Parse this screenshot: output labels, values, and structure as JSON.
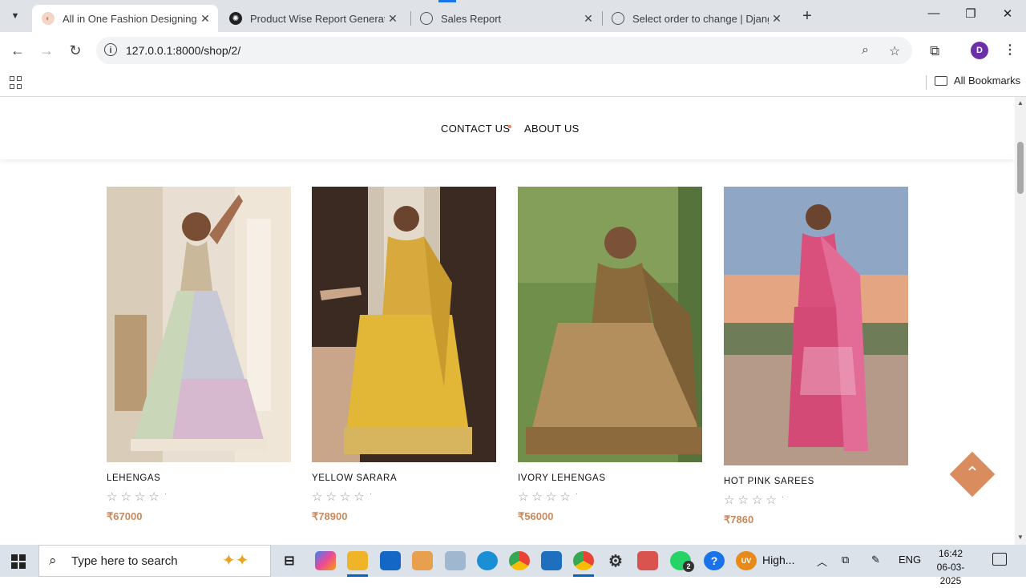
{
  "browser": {
    "tabs": [
      {
        "title": "All in One Fashion Designing",
        "active": true
      },
      {
        "title": "Product Wise Report Generation"
      },
      {
        "title": "Sales Report"
      },
      {
        "title": "Select order to change | Django"
      }
    ],
    "new_tab_symbol": "+",
    "window_controls": {
      "minimize": "—",
      "maximize": "❐",
      "close": "✕"
    },
    "address": "127.0.0.1:8000/shop/2/",
    "profile_initial": "D",
    "bookmarks_label": "All Bookmarks"
  },
  "site": {
    "nav": {
      "contact": "CONTACT US",
      "about": "ABOUT US"
    },
    "products": [
      {
        "name": "LEHENGAS",
        "price": "₹67000",
        "rating": 0,
        "rating_count": "·"
      },
      {
        "name": "YELLOW SARARA",
        "price": "₹78900",
        "rating": 0,
        "rating_count": "·"
      },
      {
        "name": "IVORY LEHENGAS",
        "price": "₹56000",
        "rating": 0,
        "rating_count": "·"
      },
      {
        "name": "HOT PINK SAREES",
        "price": "₹7860",
        "rating": 0,
        "rating_count": "·"
      }
    ],
    "back_to_top_icon": "chevron-up-icon",
    "accent_color": "#d98d5e"
  },
  "taskbar": {
    "search_placeholder": "Type here to search",
    "weather_text": "High...",
    "weather_badge": "UV",
    "whatsapp_badge": "2",
    "language": "ENG",
    "time": "16:42",
    "date": "06-03-2025"
  }
}
